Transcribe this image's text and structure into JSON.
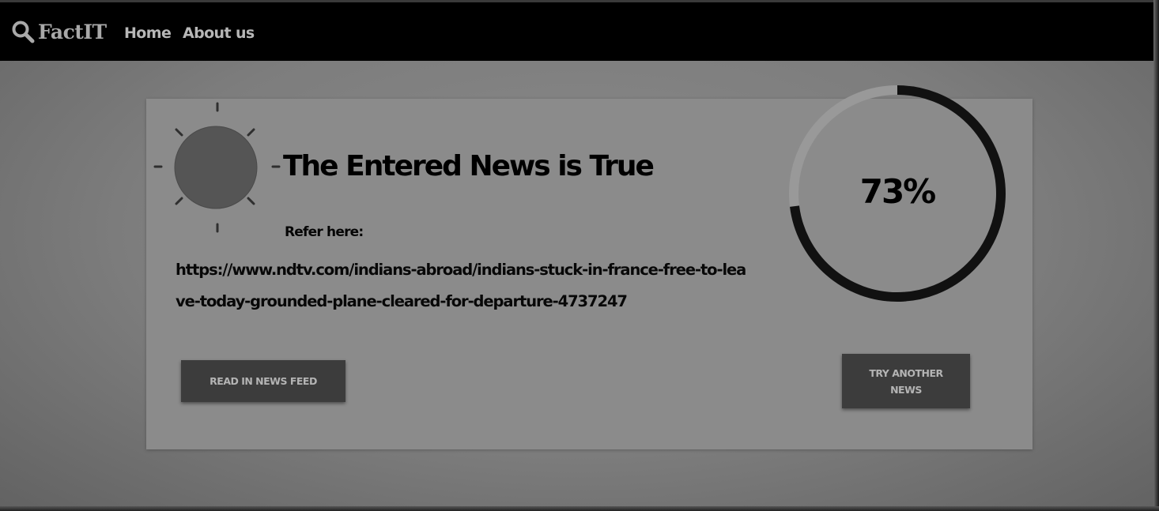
{
  "navbar": {
    "brand": "FactIT",
    "links": [
      "Home",
      "About us"
    ]
  },
  "result": {
    "headline": "The Entered News is True",
    "refer_label": "Refer here:",
    "refer_url": "https://www.ndtv.com/indians-abroad/indians-stuck-in-france-free-to-leave-today-grounded-plane-cleared-for-departure-4737247",
    "confidence_label": "73%",
    "confidence_value": 73
  },
  "buttons": {
    "read": "READ IN NEWS FEED",
    "try_another": "TRY ANOTHER NEWS"
  },
  "colors": {
    "navbar": "#000000",
    "progress": "#111111",
    "track": "#999999",
    "sun": "#555555"
  },
  "icons": {
    "brand": "search-icon",
    "status": "sun-icon"
  }
}
